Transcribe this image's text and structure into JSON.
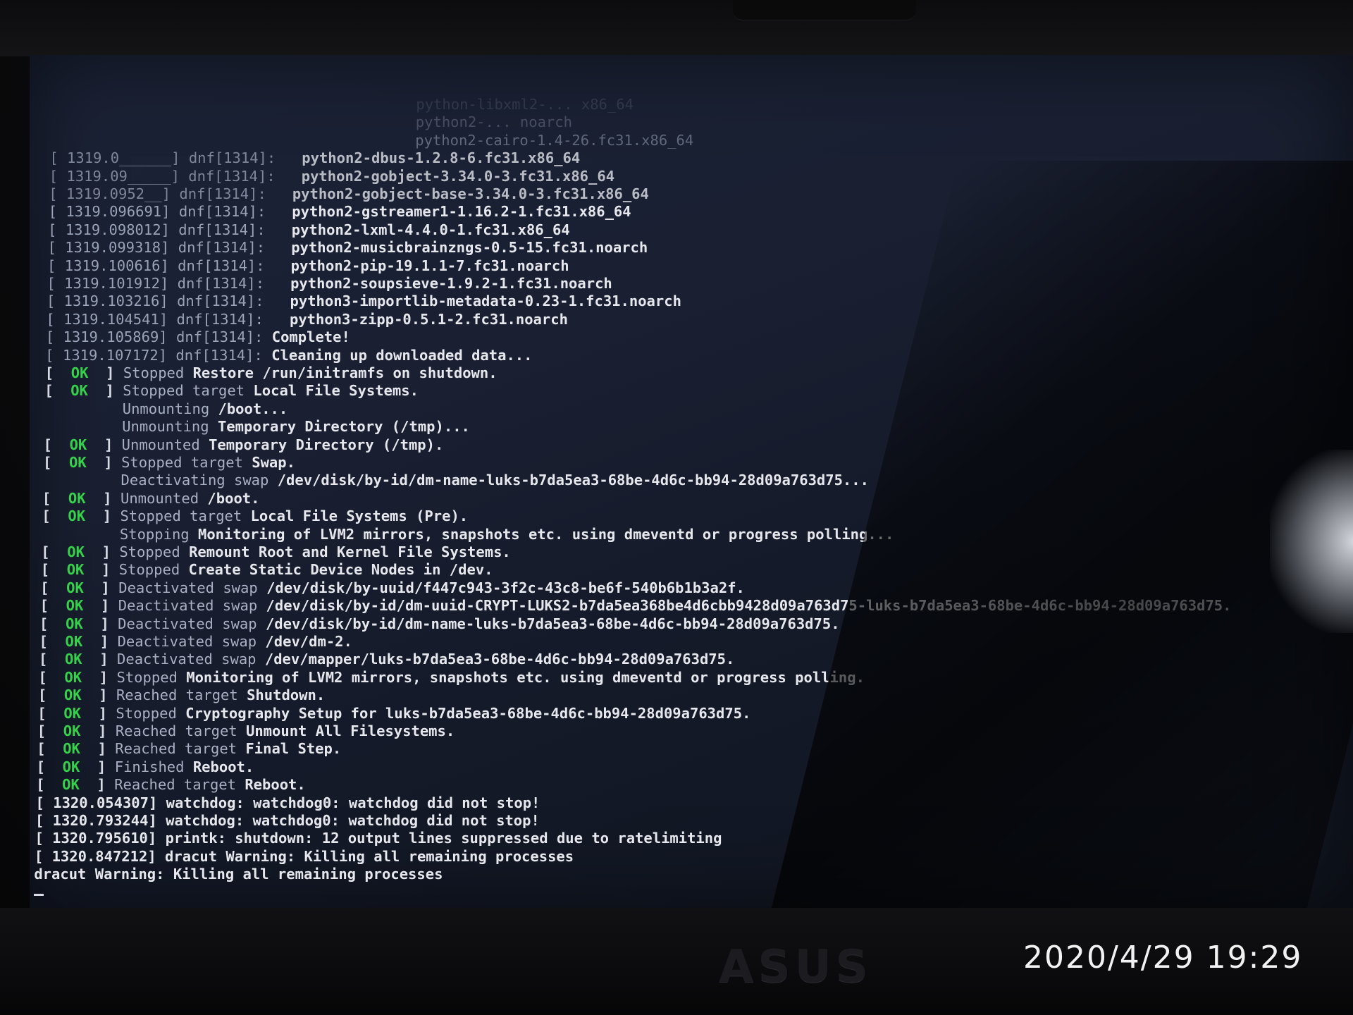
{
  "brand": "ASUS",
  "timestamp": "2020/4/29  19:29",
  "cursor": "_",
  "console": {
    "faded": [
      "                                          python-libxml2-... x86_64",
      "                                          python2-... noarch",
      "                                          python2-cairo-1.4-26.fc31.x86_64"
    ],
    "package_lines": [
      {
        "prefix": "[ 1319.0______] dnf[1314]:",
        "text": "python2-dbus-1.2.8-6.fc31.x86_64"
      },
      {
        "prefix": "[ 1319.09_____] dnf[1314]:",
        "text": "python2-gobject-3.34.0-3.fc31.x86_64"
      },
      {
        "prefix": "[ 1319.0952__] dnf[1314]:",
        "text": "python2-gobject-base-3.34.0-3.fc31.x86_64"
      },
      {
        "prefix": "[ 1319.096691] dnf[1314]:",
        "text": "python2-gstreamer1-1.16.2-1.fc31.x86_64"
      },
      {
        "prefix": "[ 1319.098012] dnf[1314]:",
        "text": "python2-lxml-4.4.0-1.fc31.x86_64"
      },
      {
        "prefix": "[ 1319.099318] dnf[1314]:",
        "text": "python2-musicbrainzngs-0.5-15.fc31.noarch"
      },
      {
        "prefix": "[ 1319.100616] dnf[1314]:",
        "text": "python2-pip-19.1.1-7.fc31.noarch"
      },
      {
        "prefix": "[ 1319.101912] dnf[1314]:",
        "text": "python2-soupsieve-1.9.2-1.fc31.noarch"
      },
      {
        "prefix": "[ 1319.103216] dnf[1314]:",
        "text": "python3-importlib-metadata-0.23-1.fc31.noarch"
      },
      {
        "prefix": "[ 1319.104541] dnf[1314]:",
        "text": "python3-zipp-0.5.1-2.fc31.noarch"
      },
      {
        "prefix": "[ 1319.105869] dnf[1314]:",
        "text": "Complete!"
      },
      {
        "prefix": "[ 1319.107172] dnf[1314]:",
        "text": "Cleaning up downloaded data..."
      }
    ],
    "systemd_lines": [
      {
        "ok": true,
        "verb": "Stopped",
        "text": "Restore /run/initramfs on shutdown."
      },
      {
        "ok": true,
        "verb": "Stopped target",
        "text": "Local File Systems."
      },
      {
        "ok": false,
        "verb": "Unmounting",
        "text": "/boot..."
      },
      {
        "ok": false,
        "verb": "Unmounting",
        "text": "Temporary Directory (/tmp)..."
      },
      {
        "ok": true,
        "verb": "Unmounted",
        "text": "Temporary Directory (/tmp)."
      },
      {
        "ok": true,
        "verb": "Stopped target",
        "text": "Swap."
      },
      {
        "ok": false,
        "verb": "Deactivating swap",
        "text": "/dev/disk/by-id/dm-name-luks-b7da5ea3-68be-4d6c-bb94-28d09a763d75..."
      },
      {
        "ok": true,
        "verb": "Unmounted",
        "text": "/boot."
      },
      {
        "ok": true,
        "verb": "Stopped target",
        "text": "Local File Systems (Pre)."
      },
      {
        "ok": false,
        "verb": "Stopping",
        "text": "Monitoring of LVM2 mirrors, snapshots etc. using dmeventd or progress polling..."
      },
      {
        "ok": true,
        "verb": "Stopped",
        "text": "Remount Root and Kernel File Systems."
      },
      {
        "ok": true,
        "verb": "Stopped",
        "text": "Create Static Device Nodes in /dev."
      },
      {
        "ok": true,
        "verb": "Deactivated swap",
        "text": "/dev/disk/by-uuid/f447c943-3f2c-43c8-be6f-540b6b1b3a2f."
      },
      {
        "ok": true,
        "verb": "Deactivated swap",
        "text": "/dev/disk/by-id/dm-uuid-CRYPT-LUKS2-b7da5ea368be4d6cbb9428d09a763d75-luks-b7da5ea3-68be-4d6c-bb94-28d09a763d75."
      },
      {
        "ok": true,
        "verb": "Deactivated swap",
        "text": "/dev/disk/by-id/dm-name-luks-b7da5ea3-68be-4d6c-bb94-28d09a763d75."
      },
      {
        "ok": true,
        "verb": "Deactivated swap",
        "text": "/dev/dm-2."
      },
      {
        "ok": true,
        "verb": "Deactivated swap",
        "text": "/dev/mapper/luks-b7da5ea3-68be-4d6c-bb94-28d09a763d75."
      },
      {
        "ok": true,
        "verb": "Stopped",
        "text": "Monitoring of LVM2 mirrors, snapshots etc. using dmeventd or progress polling."
      },
      {
        "ok": true,
        "verb": "Reached target",
        "text": "Shutdown."
      },
      {
        "ok": true,
        "verb": "Stopped",
        "text": "Cryptography Setup for luks-b7da5ea3-68be-4d6c-bb94-28d09a763d75."
      },
      {
        "ok": true,
        "verb": "Reached target",
        "text": "Unmount All Filesystems."
      },
      {
        "ok": true,
        "verb": "Reached target",
        "text": "Final Step."
      },
      {
        "ok": true,
        "verb": "Finished",
        "text": "Reboot."
      },
      {
        "ok": true,
        "verb": "Reached target",
        "text": "Reboot."
      }
    ],
    "ok_label": "OK",
    "kernel_lines": [
      "[ 1320.054307] watchdog: watchdog0: watchdog did not stop!",
      "[ 1320.793244] watchdog: watchdog0: watchdog did not stop!",
      "[ 1320.795610] printk: shutdown: 12 output lines suppressed due to ratelimiting",
      "[ 1320.847212] dracut Warning: Killing all remaining processes",
      "dracut Warning: Killing all remaining processes"
    ]
  }
}
